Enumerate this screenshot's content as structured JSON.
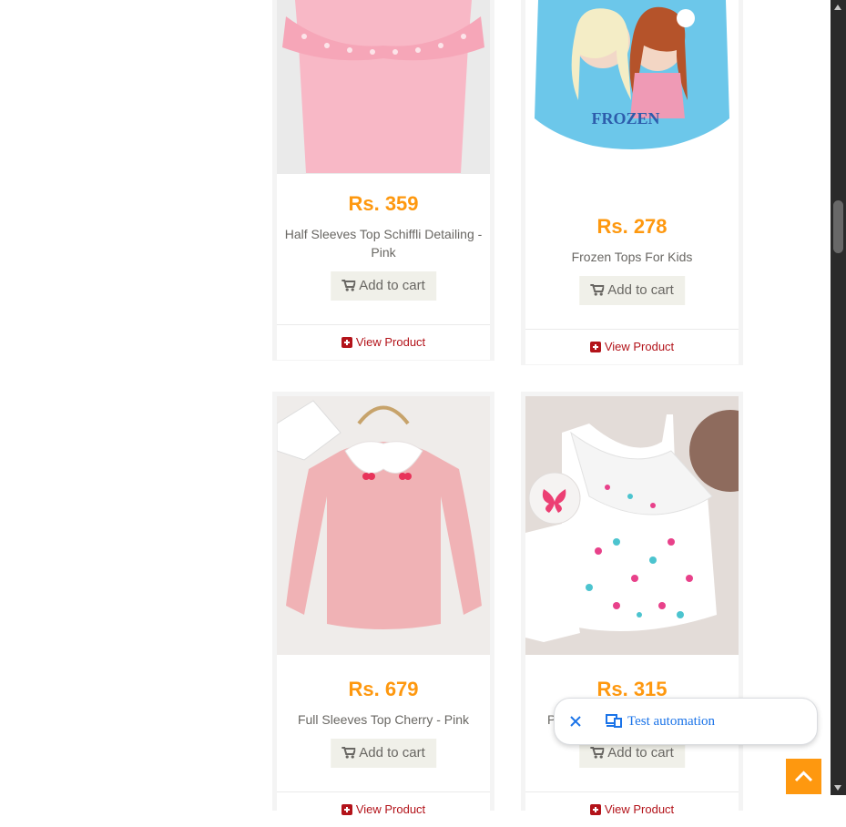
{
  "products": [
    {
      "price": "Rs. 359",
      "name": "Half Sleeves Top Schiffli Detailing - Pink",
      "cart_label": "Add to cart",
      "view_label": "View Product"
    },
    {
      "price": "Rs. 278",
      "name": "Frozen Tops For Kids",
      "cart_label": "Add to cart",
      "view_label": "View Product"
    },
    {
      "price": "Rs. 679",
      "name": "Full Sleeves Top Cherry - Pink",
      "cart_label": "Add to cart",
      "view_label": "View Product"
    },
    {
      "price": "Rs. 315",
      "name": "Pri",
      "cart_label": "Add to cart",
      "view_label": "View Product"
    }
  ],
  "toast": {
    "label": "Test automation"
  },
  "colors": {
    "price": "#fe980f",
    "view_link": "#b3131a",
    "accent": "#fe980f",
    "toast_text": "#1a73e8"
  },
  "icons": [
    "shopping-cart-icon",
    "plus-square-icon",
    "close-icon",
    "devices-icon",
    "chevron-up-icon"
  ]
}
